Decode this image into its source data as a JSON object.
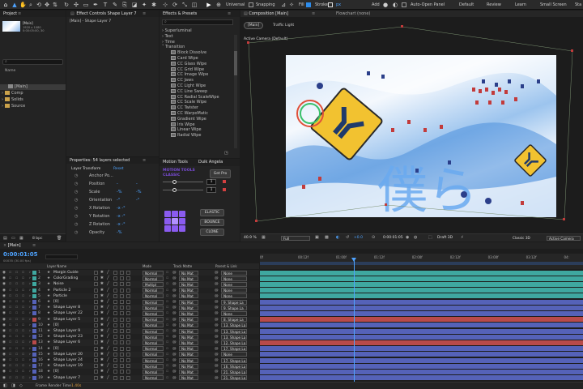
{
  "toolbar": {
    "labels": [
      "Universal",
      "Snapping",
      "Fill",
      "Stroke",
      "px",
      "Add",
      "Auto-Open Panel"
    ],
    "workspaces": [
      "Default",
      "Review",
      "Learn",
      "Small Screen",
      "Sta"
    ]
  },
  "project": {
    "title": "Project",
    "comp_name": "[Main]",
    "comp_info": "1920 x 1080\n0:00:05:00, 30",
    "name_header": "Name",
    "items": [
      "[Main]",
      "Comp",
      "Solids",
      "Source"
    ],
    "bpc": "8 bpc"
  },
  "effect_controls": {
    "title": "Effect Controls Shape Layer 7",
    "subtitle": "[Main] - Shape Layer 7"
  },
  "properties": {
    "title": "Properties: 54 layers selected",
    "section": "Layer Transform",
    "reset": "Reset",
    "rows": [
      {
        "label": "Anchor Po...",
        "v1": "",
        "v2": ""
      },
      {
        "label": "Position",
        "v1": "-",
        "v2": "-"
      },
      {
        "label": "Scale",
        "v1": "-%",
        "v2": "-%"
      },
      {
        "label": "Orientation",
        "v1": "-°",
        "v2": "-°"
      },
      {
        "label": "X Rotation",
        "v1": "-x -°",
        "v2": ""
      },
      {
        "label": "Y Rotation",
        "v1": "-x -°",
        "v2": ""
      },
      {
        "label": "Z Rotation",
        "v1": "-x -°",
        "v2": ""
      },
      {
        "label": "Opacity",
        "v1": "-%",
        "v2": ""
      }
    ]
  },
  "effects_presets": {
    "title": "Effects & Presets",
    "categories": [
      "Superluminal",
      "Text",
      "Time",
      "Transition"
    ],
    "items": [
      "Block Dissolve",
      "Card Wipe",
      "CC Glass Wipe",
      "CC Grid Wipe",
      "CC Image Wipe",
      "CC Jaws",
      "CC Light Wipe",
      "CC Line Sweep",
      "CC Radial ScaleWipe",
      "CC Scale Wipe",
      "CC Twister",
      "CC WarpoMatic",
      "Gradient Wipe",
      "Iris Wipe",
      "Linear Wipe",
      "Radial Wipe"
    ]
  },
  "motion_tools": {
    "tabs": [
      "Motion Tools",
      "Duik Angela"
    ],
    "brand": "MOTION TOOLS",
    "edition": "CLASSIC",
    "get_pro": "Get Pro",
    "values": [
      "1",
      "1"
    ],
    "buttons": [
      "ELASTIC",
      "BOUNCE",
      "CLONE"
    ]
  },
  "composition": {
    "tab": "Composition [Main]",
    "flowchart": "Flowchart (none)",
    "breadcrumb": [
      "[Main]",
      "Traffic Light"
    ],
    "camera": "Active Camera (Default)",
    "zoom": "40.9 %",
    "resolution": "Full",
    "time": "0:00:01:05",
    "draft": "Draft 3D",
    "renderer": "Classic 3D",
    "camera_select": "Active Camera"
  },
  "timeline": {
    "tab": "[Main]",
    "timecode": "0:00:01:05",
    "frame_info": "00035 (30.00 fps)",
    "headers": {
      "name": "Layer Name",
      "mode": "Mode",
      "track": "Track Matte",
      "parent": "Parent & Link"
    },
    "ruler": [
      "0f",
      "00:12f",
      "01:00f",
      "01:12f",
      "02:00f",
      "02:12f",
      "03:00f",
      "03:12f",
      "04:"
    ],
    "layers": [
      {
        "num": "1",
        "name": "Margin Guide",
        "mode": "Normal",
        "matte": "No Mat",
        "parent": "None",
        "color": "#3fa8a0"
      },
      {
        "num": "2",
        "name": "ColorGrading",
        "mode": "Normal",
        "matte": "No Mat",
        "parent": "None",
        "color": "#3fa8a0"
      },
      {
        "num": "3",
        "name": "Noise",
        "mode": "Multipl",
        "matte": "No Mat",
        "parent": "None",
        "color": "#3fa8a0"
      },
      {
        "num": "4",
        "name": "Particle 2",
        "mode": "Normal",
        "matte": "No Mat",
        "parent": "None",
        "color": "#3fa8a0"
      },
      {
        "num": "5",
        "name": "Particle",
        "mode": "Normal",
        "matte": "No Mat",
        "parent": "None",
        "color": "#3fa8a0"
      },
      {
        "num": "6",
        "name": "[0]",
        "mode": "Normal",
        "matte": "No Mat",
        "parent": "9. Shape La",
        "color": "#5562b8"
      },
      {
        "num": "7",
        "name": "Shape Layer 8",
        "mode": "Normal",
        "matte": "No Mat",
        "parent": "9. Shape La",
        "color": "#5562b8"
      },
      {
        "num": "8",
        "name": "Shape Layer 22",
        "mode": "Normal",
        "matte": "No Mat",
        "parent": "None",
        "color": "#5562b8"
      },
      {
        "num": "9",
        "name": "Shape Layer 5",
        "mode": "Normal",
        "matte": "No Mat",
        "parent": "8. Shape La",
        "color": "#b84a4a"
      },
      {
        "num": "10",
        "name": "[0]",
        "mode": "Normal",
        "matte": "No Mat",
        "parent": "13. Shape La",
        "color": "#5562b8"
      },
      {
        "num": "11",
        "name": "Shape Layer 9",
        "mode": "Normal",
        "matte": "No Mat",
        "parent": "13. Shape La",
        "color": "#5562b8"
      },
      {
        "num": "12",
        "name": "Shape Layer 23",
        "mode": "Normal",
        "matte": "No Mat",
        "parent": "13. Shape La",
        "color": "#5562b8"
      },
      {
        "num": "13",
        "name": "Shape Layer 6",
        "mode": "Normal",
        "matte": "No Mat",
        "parent": "12. Shape La",
        "color": "#b84a4a"
      },
      {
        "num": "14",
        "name": "[0]",
        "mode": "Normal",
        "matte": "No Mat",
        "parent": "17. Shape La",
        "color": "#5562b8"
      },
      {
        "num": "15",
        "name": "Shape Layer 20",
        "mode": "Normal",
        "matte": "No Mat",
        "parent": "None",
        "color": "#5562b8"
      },
      {
        "num": "16",
        "name": "Shape Layer 24",
        "mode": "Normal",
        "matte": "No Mat",
        "parent": "17. Shape La",
        "color": "#5562b8"
      },
      {
        "num": "17",
        "name": "Shape Layer 19",
        "mode": "Normal",
        "matte": "No Mat",
        "parent": "16. Shape La",
        "color": "#5562b8"
      },
      {
        "num": "18",
        "name": "[0]",
        "mode": "Normal",
        "matte": "No Mat",
        "parent": "21. Shape La",
        "color": "#5562b8"
      },
      {
        "num": "19",
        "name": "Shape Layer 7",
        "mode": "Normal",
        "matte": "No Mat",
        "parent": "21. Shape La",
        "color": "#5562b8"
      }
    ],
    "footer": "Frame Render Time",
    "footer_value": "1.40s"
  },
  "colors": {
    "accent": "#2d8ceb",
    "teal": "#3fa8a0",
    "blue": "#5562b8",
    "red": "#b84a4a",
    "purple": "#7a4cd8"
  }
}
